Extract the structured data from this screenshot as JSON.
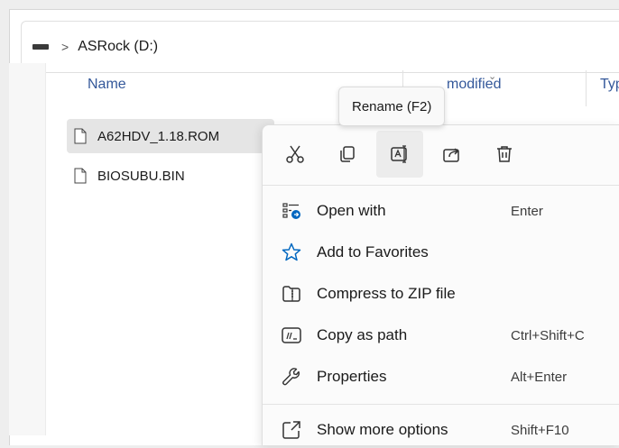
{
  "address": {
    "location": "ASRock (D:)",
    "separator": ">"
  },
  "columns": {
    "name": "Name",
    "modified": "modified",
    "type": "Typ"
  },
  "files": [
    {
      "name": "A62HDV_1.18.ROM",
      "selected": true
    },
    {
      "name": "BIOSUBU.BIN",
      "selected": false
    }
  ],
  "tooltip": {
    "text": "Rename (F2)"
  },
  "context_menu": {
    "actions": [
      "cut-icon",
      "copy-icon",
      "rename-icon",
      "share-icon",
      "delete-icon"
    ],
    "items": [
      {
        "label": "Open with",
        "shortcut": "Enter",
        "icon": "open-with-icon"
      },
      {
        "label": "Add to Favorites",
        "shortcut": "",
        "icon": "star-icon"
      },
      {
        "label": "Compress to ZIP file",
        "shortcut": "",
        "icon": "zip-folder-icon"
      },
      {
        "label": "Copy as path",
        "shortcut": "Ctrl+Shift+C",
        "icon": "copy-path-icon"
      },
      {
        "label": "Properties",
        "shortcut": "Alt+Enter",
        "icon": "wrench-icon"
      },
      {
        "label": "Show more options",
        "shortcut": "Shift+F10",
        "icon": "more-options-icon"
      }
    ]
  },
  "colors": {
    "accent": "#0067c0",
    "column_header": "#34589a",
    "selection": "#e5e5e5"
  }
}
